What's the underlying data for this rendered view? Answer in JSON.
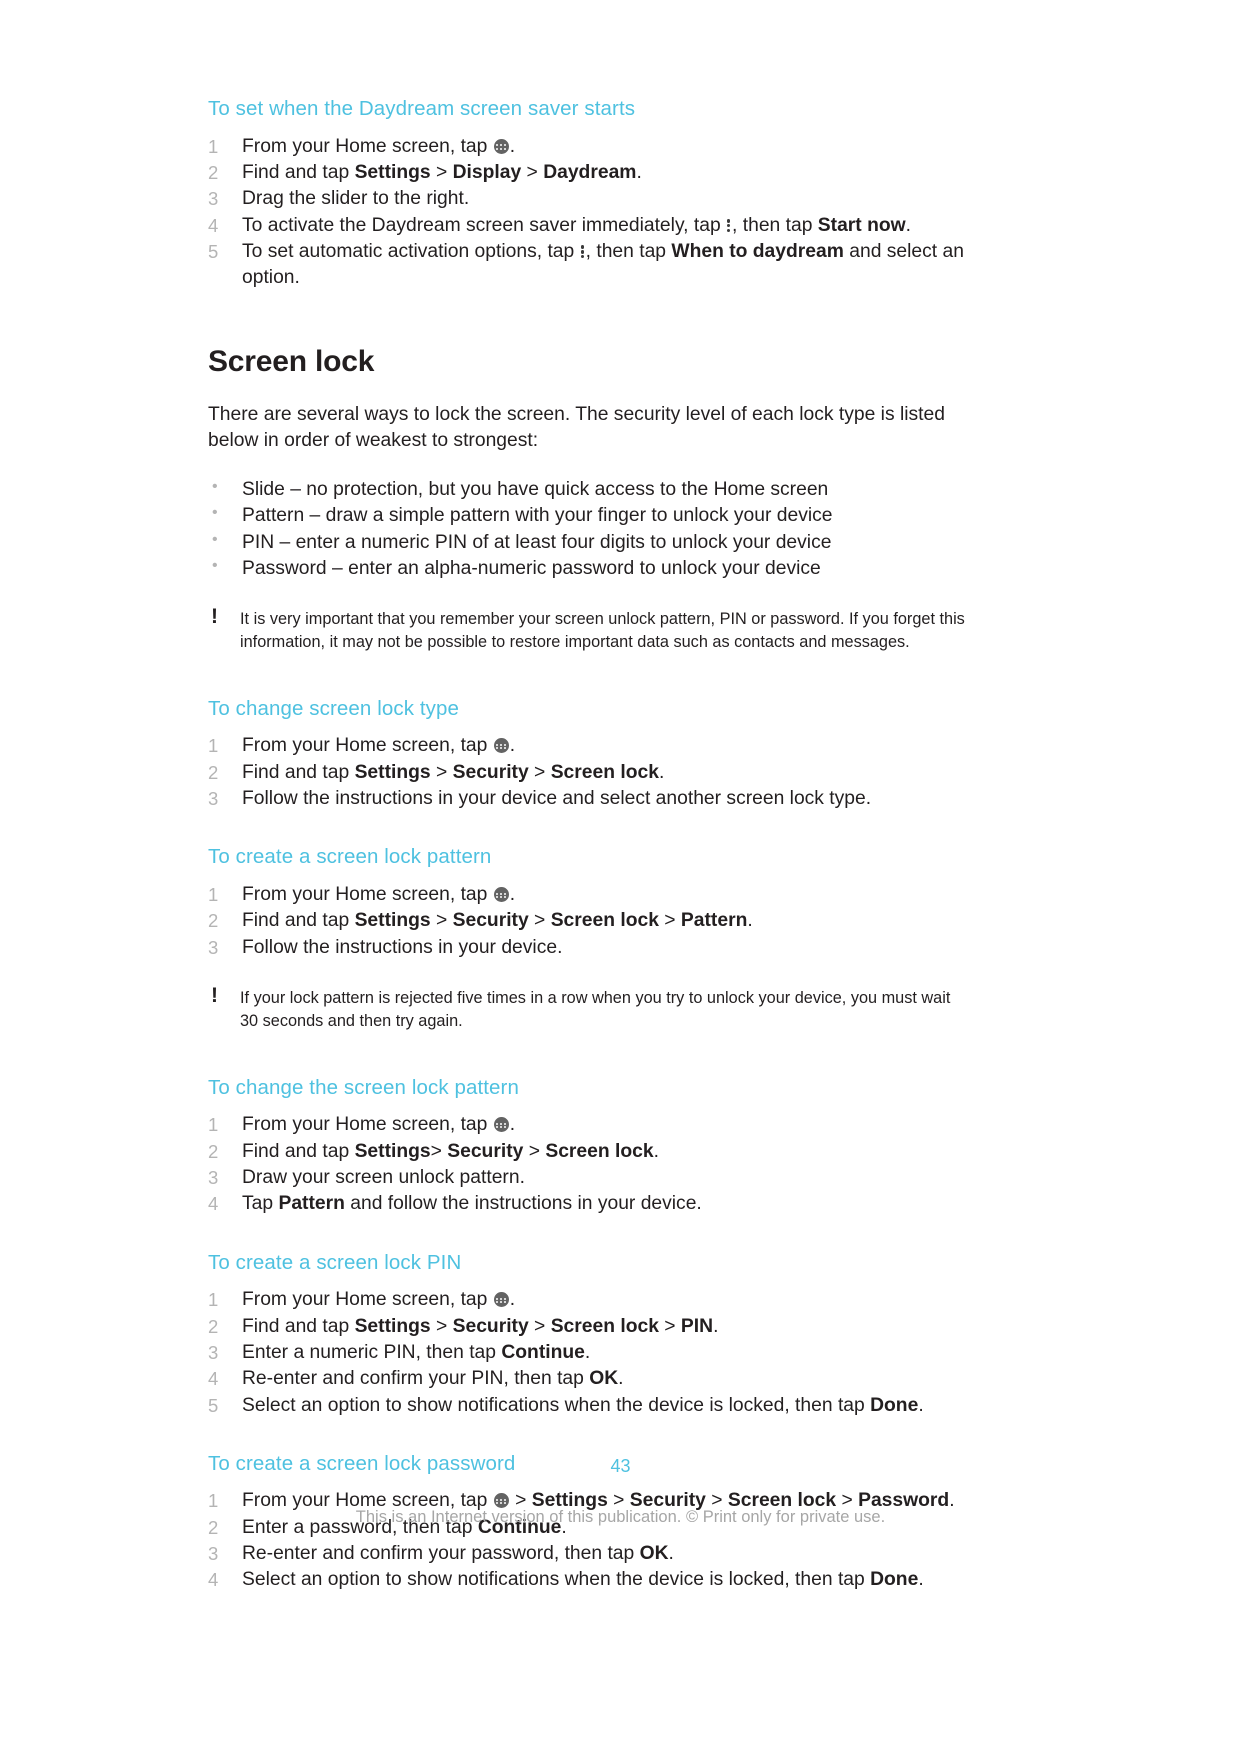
{
  "document": {
    "page_number": "43",
    "footer_note": "This is an Internet version of this publication. © Print only for private use.",
    "heading_color": "#4ec1e0",
    "text_color": "#231f20",
    "number_color": "#b4b4b4"
  },
  "sections": {
    "daydream": {
      "heading": "To set when the Daydream screen saver starts",
      "steps": [
        {
          "num": "1",
          "a": "From your Home screen, tap",
          "icon": "app-drawer-icon",
          "b": "."
        },
        {
          "num": "2",
          "pre": "Find and tap ",
          "b1": "Settings",
          "s1": " > ",
          "b2": "Display",
          "s2": " > ",
          "b3": "Daydream",
          "post": "."
        },
        {
          "num": "3",
          "text": "Drag the slider to the right."
        },
        {
          "num": "4",
          "a": "To activate the Daydream screen saver immediately, tap",
          "icon": "overflow-menu-icon",
          "mid": ", then tap ",
          "bold": "Start now",
          "post": "."
        },
        {
          "num": "5",
          "a": "To set automatic activation options, tap",
          "icon": "overflow-menu-icon",
          "mid": ", then tap ",
          "bold": "When to daydream",
          "post": " and select an option."
        }
      ]
    },
    "screen_lock": {
      "title": "Screen lock",
      "intro": "There are several ways to lock the screen. The security level of each lock type is listed below in order of weakest to strongest:",
      "bullets": [
        "Slide – no protection, but you have quick access to the Home screen",
        "Pattern – draw a simple pattern with your finger to unlock your device",
        "PIN – enter a numeric PIN of at least four digits to unlock your device",
        "Password – enter an alpha-numeric password to unlock your device"
      ],
      "note": "It is very important that you remember your screen unlock pattern, PIN or password. If you forget this information, it may not be possible to restore important data such as contacts and messages."
    },
    "change_type": {
      "heading": "To change screen lock type",
      "steps": [
        {
          "num": "1",
          "a": "From your Home screen, tap",
          "icon": "app-drawer-icon",
          "b": "."
        },
        {
          "num": "2",
          "pre": "Find and tap ",
          "b1": "Settings",
          "s1": " > ",
          "b2": "Security",
          "s2": " > ",
          "b3": "Screen lock",
          "post": "."
        },
        {
          "num": "3",
          "text": "Follow the instructions in your device and select another screen lock type."
        }
      ]
    },
    "create_pattern": {
      "heading": "To create a screen lock pattern",
      "steps": [
        {
          "num": "1",
          "a": "From your Home screen, tap",
          "icon": "app-drawer-icon",
          "b": "."
        },
        {
          "num": "2",
          "pre": "Find and tap ",
          "b1": "Settings",
          "s1": " > ",
          "b2": "Security",
          "s2": " > ",
          "b3": "Screen lock",
          "s3": " > ",
          "b4": "Pattern",
          "post": "."
        },
        {
          "num": "3",
          "text": "Follow the instructions in your device."
        }
      ],
      "note": "If your lock pattern is rejected five times in a row when you try to unlock your device, you must wait 30 seconds and then try again."
    },
    "change_pattern": {
      "heading": "To change the screen lock pattern",
      "steps": [
        {
          "num": "1",
          "a": "From your Home screen, tap",
          "icon": "app-drawer-icon",
          "b": "."
        },
        {
          "num": "2",
          "pre": "Find and tap ",
          "b1": "Settings",
          "s1": "> ",
          "b2": "Security",
          "s2": " > ",
          "b3": "Screen lock",
          "post": "."
        },
        {
          "num": "3",
          "text": "Draw your screen unlock pattern."
        },
        {
          "num": "4",
          "pre": "Tap ",
          "bold": "Pattern",
          "post": " and follow the instructions in your device."
        }
      ]
    },
    "create_pin": {
      "heading": "To create a screen lock PIN",
      "steps": [
        {
          "num": "1",
          "a": "From your Home screen, tap",
          "icon": "app-drawer-icon",
          "b": "."
        },
        {
          "num": "2",
          "pre": "Find and tap ",
          "b1": "Settings",
          "s1": " > ",
          "b2": "Security",
          "s2": " > ",
          "b3": "Screen lock",
          "s3": " > ",
          "b4": "PIN",
          "post": "."
        },
        {
          "num": "3",
          "pre": "Enter a numeric PIN, then tap ",
          "bold": "Continue",
          "post": "."
        },
        {
          "num": "4",
          "pre": "Re-enter and confirm your PIN, then tap ",
          "bold": "OK",
          "post": "."
        },
        {
          "num": "5",
          "pre": "Select an option to show notifications when the device is locked, then tap ",
          "bold": "Done",
          "post": "."
        }
      ]
    },
    "create_password": {
      "heading": "To create a screen lock password",
      "steps": [
        {
          "num": "1",
          "a": "From your Home screen, tap",
          "icon": "app-drawer-icon",
          "pre2": " > ",
          "b1": "Settings",
          "s1": " > ",
          "b2": "Security",
          "s2": " > ",
          "b3": "Screen lock",
          "s3": " > ",
          "b4": "Password",
          "post": "."
        },
        {
          "num": "2",
          "pre": "Enter a password, then tap ",
          "bold": "Continue",
          "post": "."
        },
        {
          "num": "3",
          "pre": "Re-enter and confirm your password, then tap ",
          "bold": "OK",
          "post": "."
        },
        {
          "num": "4",
          "pre": "Select an option to show notifications when the device is locked, then tap ",
          "bold": "Done",
          "post": "."
        }
      ]
    }
  }
}
